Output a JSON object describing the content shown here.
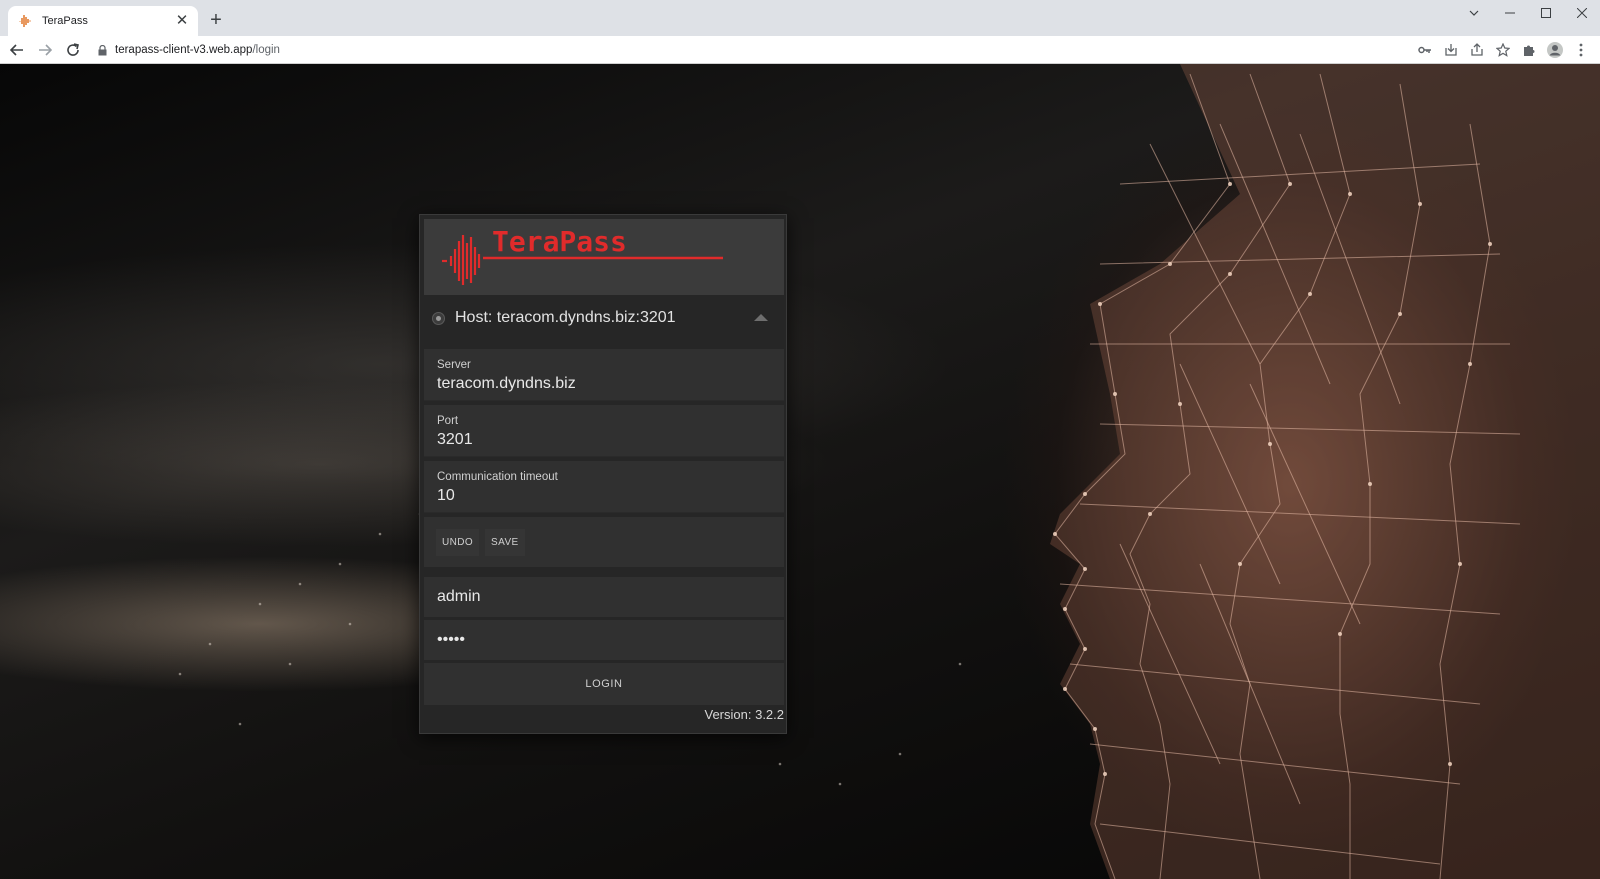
{
  "browser": {
    "tab_title": "TeraPass",
    "tab_close": "✕",
    "new_tab": "+",
    "url_host": "terapass-client-v3.web.app",
    "url_path": "/login"
  },
  "logo": {
    "text": "TeraPass",
    "color": "#e02b2b"
  },
  "host_bar": {
    "label": "Host: teracom.dyndns.biz:3201"
  },
  "fields": {
    "server": {
      "label": "Server",
      "value": "teracom.dyndns.biz"
    },
    "port": {
      "label": "Port",
      "value": "3201"
    },
    "timeout": {
      "label": "Communication timeout",
      "value": "10"
    }
  },
  "actions": {
    "undo_label": "UNDO",
    "save_label": "SAVE"
  },
  "credentials": {
    "username": "admin",
    "password": "•••••"
  },
  "login_label": "LOGIN",
  "version": "Version: 3.2.2"
}
